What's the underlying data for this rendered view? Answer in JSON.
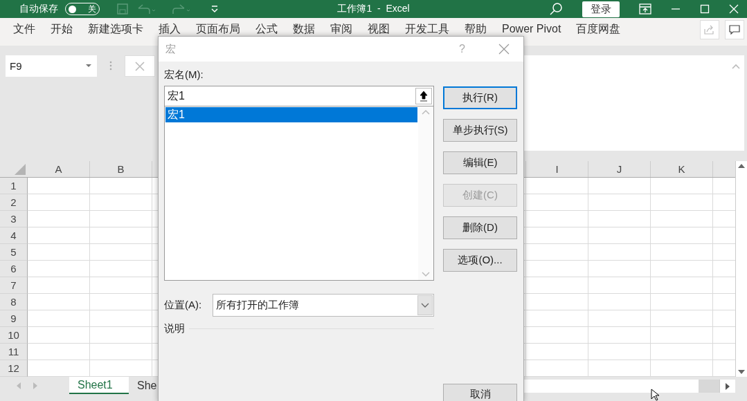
{
  "title_bar": {
    "autosave": {
      "label": "自动保存",
      "toggle_text": "关",
      "on": false
    },
    "title": "工作簿1  -  Excel",
    "sign_in": "登录"
  },
  "ribbon_tabs": [
    {
      "label": "文件",
      "selected": false
    },
    {
      "label": "开始",
      "selected": false
    },
    {
      "label": "新建选项卡",
      "selected": false
    },
    {
      "label": "插入",
      "selected": false
    },
    {
      "label": "页面布局",
      "selected": false
    },
    {
      "label": "公式",
      "selected": false
    },
    {
      "label": "数据",
      "selected": false
    },
    {
      "label": "审阅",
      "selected": false
    },
    {
      "label": "视图",
      "selected": false
    },
    {
      "label": "开发工具",
      "selected": false
    },
    {
      "label": "帮助",
      "selected": false
    },
    {
      "label": "Power Pivot",
      "selected": false
    },
    {
      "label": "百度网盘",
      "selected": false
    }
  ],
  "name_box": "F9",
  "sheet": {
    "columns": [
      "A",
      "B",
      "I",
      "J",
      "K"
    ],
    "rows": [
      "1",
      "2",
      "3",
      "4",
      "5",
      "6",
      "7",
      "8",
      "9",
      "10",
      "11",
      "12"
    ]
  },
  "sheet_tabs": [
    {
      "label": "Sheet1",
      "selected": true
    },
    {
      "label": "She",
      "selected": false
    }
  ],
  "dialog": {
    "title": "宏",
    "help": "?",
    "name_label": "宏名(M):",
    "name_value": "宏1",
    "macro_list": [
      {
        "name": "宏1",
        "selected": true
      }
    ],
    "buttons": [
      {
        "label": "执行(R)",
        "default": true,
        "disabled": false
      },
      {
        "label": "单步执行(S)",
        "default": false,
        "disabled": false
      },
      {
        "label": "编辑(E)",
        "default": false,
        "disabled": false
      },
      {
        "label": "创建(C)",
        "default": false,
        "disabled": true
      },
      {
        "label": "删除(D)",
        "default": false,
        "disabled": false
      },
      {
        "label": "选项(O)...",
        "default": false,
        "disabled": false
      }
    ],
    "location_label": "位置(A):",
    "location_value": "所有打开的工作簿",
    "description_label": "说明",
    "cancel": "取消"
  }
}
